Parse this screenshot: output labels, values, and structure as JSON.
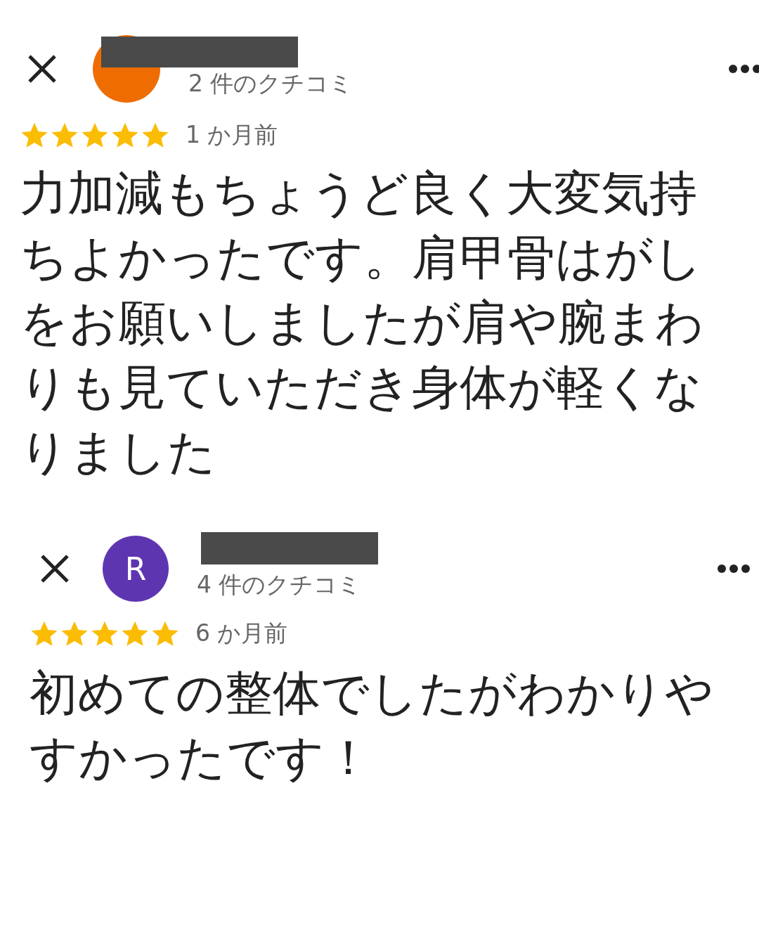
{
  "reviews": [
    {
      "avatar": {
        "color": "#ef6c00"
      },
      "review_count": "2 件のクチコミ",
      "stars": 5,
      "time": "1 か月前",
      "text": "力加減もちょうど良く大変気持ちよかったです。肩甲骨はがしをお願いしましたが肩や腕まわりも見ていただき身体が軽くなりました"
    },
    {
      "avatar": {
        "letter": "R",
        "color": "#5e35b1"
      },
      "review_count": "4 件のクチコミ",
      "stars": 5,
      "time": "6 か月前",
      "text": "初めての整体でしたがわかりやすかったです！"
    }
  ]
}
